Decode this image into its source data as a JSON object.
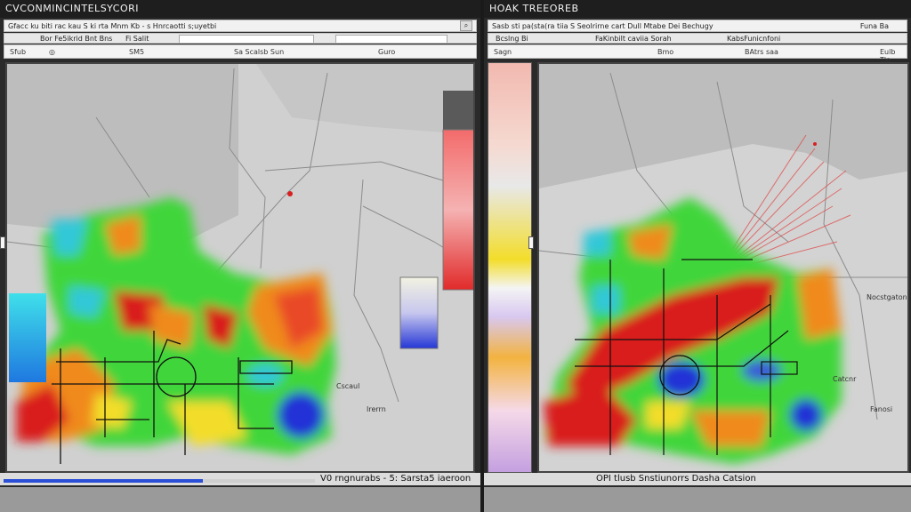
{
  "left_window": {
    "title": "CVCONMINCINTELSYCORI",
    "toolbar_text": "Gfacc ku biti rac kau S ki rta Mnm Kb - s Hnrcaotti s;uyetbi",
    "link_text": "Bor Fe5ikrid Bnt Bns",
    "link_text_2": "Fi Salit",
    "tab_label_1": "Sfub",
    "tab_label_2": "SM5",
    "tab_label_3": "Sa Scalsb Sun",
    "tab_label_4": "Guro",
    "status_text": "V0 rngnurabs - 5: Sarsta5 iaeroon",
    "map_labels": [
      "Irerrn",
      "Cscaul"
    ],
    "loading_progress": 0.64
  },
  "right_window": {
    "title": "HOAK TREEOREB",
    "toolbar_text": "Sasb sti pa(sta(ra tiia S Seolrirne cart Dull Mtabe Dei Bechugy",
    "toolbar_text_2": "Funa Ba",
    "link_text": "Bcslng Bi",
    "link_text_2": "FaKinbilt caviia Sorah",
    "link_text_3": "KabsFunicnfoni",
    "tab_label_1": "Sagn",
    "tab_label_2": "Bmo",
    "tab_label_3": "BAtrs saa",
    "tab_label_4": "Eulb Tlo",
    "status_text": "OPI tlusb Snstiunorrs Dasha Catsion",
    "map_labels": [
      "Nocstgatons",
      "Catcnr",
      "Fanosi"
    ]
  },
  "colors": {
    "heat_red": "#d91f1f",
    "heat_orange": "#f08a1d",
    "heat_yellow": "#f3dd2a",
    "heat_green": "#3fd63a",
    "heat_cyan": "#30c8d8",
    "heat_blue": "#2431d6",
    "map_background": "#d3d3d3"
  }
}
